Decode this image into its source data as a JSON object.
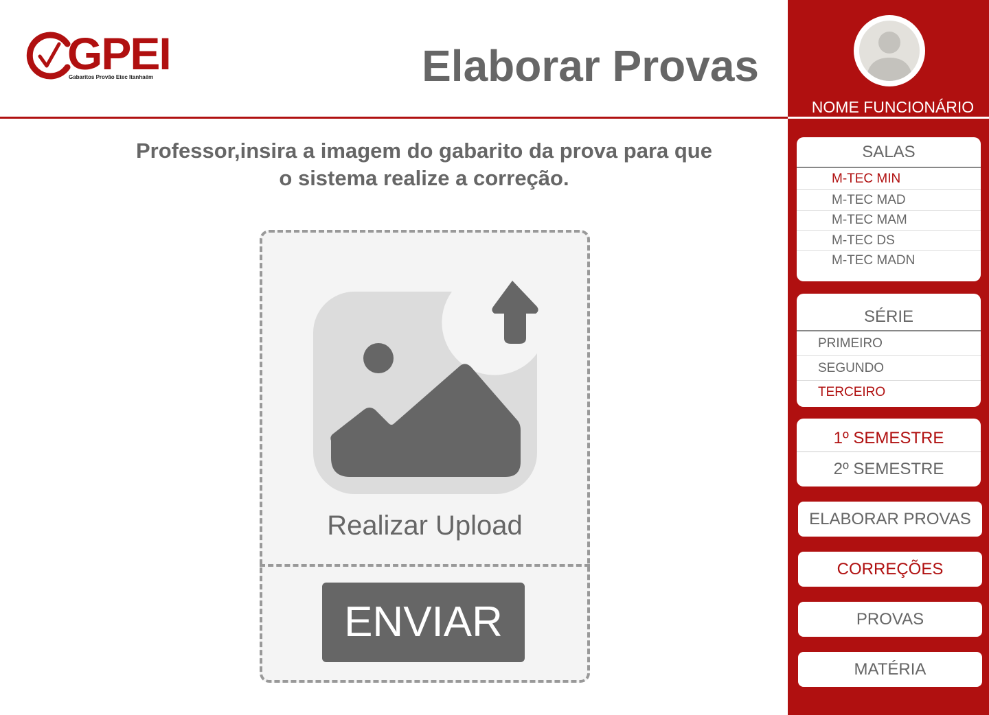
{
  "header": {
    "logo_text": "GPEI",
    "logo_subtitle": "Gabaritos Provão Etec Itanhaém",
    "title": "Elaborar Provas"
  },
  "main": {
    "instruction_line1": "Professor,insira a imagem do gabarito da prova para que",
    "instruction_line2": "o sistema realize a correção.",
    "upload_label": "Realizar Upload",
    "send_label": "ENVIAR"
  },
  "sidebar": {
    "employee_name": "NOME FUNCIONÁRIO",
    "salas": {
      "title": "SALAS",
      "items": [
        {
          "label": "M-TEC MIN",
          "active": true
        },
        {
          "label": "M-TEC MAD",
          "active": false
        },
        {
          "label": "M-TEC MAM",
          "active": false
        },
        {
          "label": "M-TEC DS",
          "active": false
        },
        {
          "label": "M-TEC MADN",
          "active": false
        }
      ]
    },
    "serie": {
      "title": "SÉRIE",
      "items": [
        {
          "label": "PRIMEIRO",
          "active": false
        },
        {
          "label": "SEGUNDO",
          "active": false
        },
        {
          "label": "TERCEIRO",
          "active": true
        }
      ]
    },
    "semestre": {
      "items": [
        {
          "label": "1º SEMESTRE",
          "active": true
        },
        {
          "label": "2º SEMESTRE",
          "active": false
        }
      ]
    },
    "nav": [
      {
        "label": "ELABORAR PROVAS",
        "active": false
      },
      {
        "label": "CORREÇÕES",
        "active": true
      },
      {
        "label": "PROVAS",
        "active": false
      },
      {
        "label": "MATÉRIA",
        "active": false
      }
    ]
  },
  "colors": {
    "brand_red": "#b01010",
    "text_gray": "#666666",
    "upload_bg": "#f4f4f4"
  },
  "icons": {
    "logo": "checkmark-circle-icon",
    "upload": "image-upload-icon",
    "avatar": "user-avatar-icon"
  }
}
